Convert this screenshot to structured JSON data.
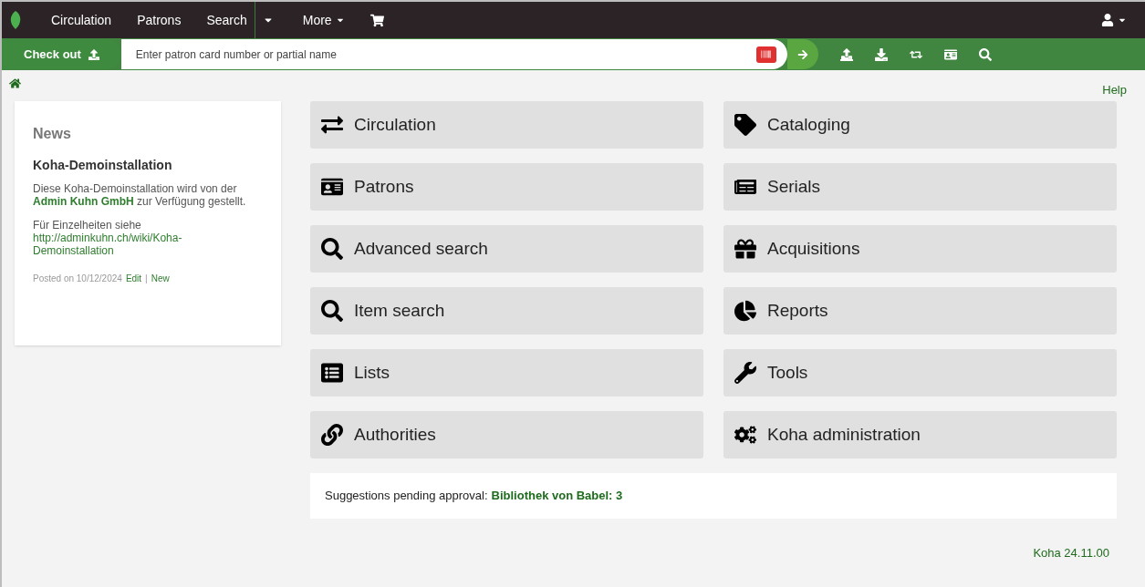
{
  "nav": {
    "items": [
      "Circulation",
      "Patrons",
      "Search"
    ],
    "more": "More"
  },
  "checkout": {
    "button": "Check out",
    "placeholder": "Enter patron card number or partial name"
  },
  "help": "Help",
  "news": {
    "title": "News",
    "heading": "Koha-Demoinstallation",
    "text_before": "Diese Koha-Demoinstallation wird von der",
    "link": "Admin Kuhn GmbH",
    "text_after": "zur Verfügung gestellt.",
    "details": "Für Einzelheiten siehe",
    "url": "http://adminkuhn.ch/wiki/Koha-Demoinstallation",
    "posted": "Posted on 10/12/2024",
    "edit": "Edit",
    "separator": "|",
    "new": "New"
  },
  "modules": [
    "Circulation",
    "Cataloging",
    "Patrons",
    "Serials",
    "Advanced search",
    "Acquisitions",
    "Item search",
    "Reports",
    "Lists",
    "Tools",
    "Authorities",
    "Koha administration"
  ],
  "pending": {
    "label": "Suggestions pending approval:",
    "link": "Bibliothek von Babel: 3"
  },
  "version": "Koha 24.11.00"
}
